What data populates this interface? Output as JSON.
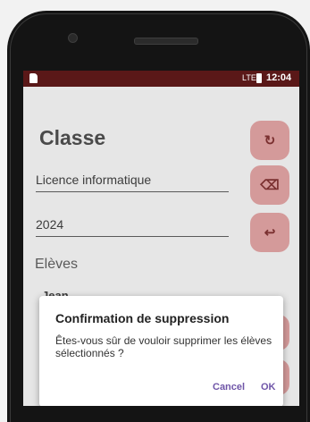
{
  "status_bar": {
    "time": "12:04",
    "network": "LTE"
  },
  "screen": {
    "title": "Classe",
    "fields": [
      {
        "value": "Licence informatique"
      },
      {
        "value": "2024"
      }
    ],
    "section_title": "Elèves",
    "students": [
      {
        "name": "Jean",
        "checked": true
      }
    ],
    "fab_icons": [
      "refresh-icon",
      "backspace-icon",
      "undo-icon",
      "hidden-icon",
      "hidden-icon"
    ]
  },
  "dialog": {
    "title": "Confirmation de suppression",
    "message": "Êtes-vous sûr de vouloir supprimer les élèves sélectionnés ?",
    "cancel_label": "Cancel",
    "ok_label": "OK"
  },
  "colors": {
    "status_bar": "#5a1818",
    "fab": "#d49a9a",
    "accent": "#6f55a8",
    "checkbox": "#8c7bb8"
  }
}
